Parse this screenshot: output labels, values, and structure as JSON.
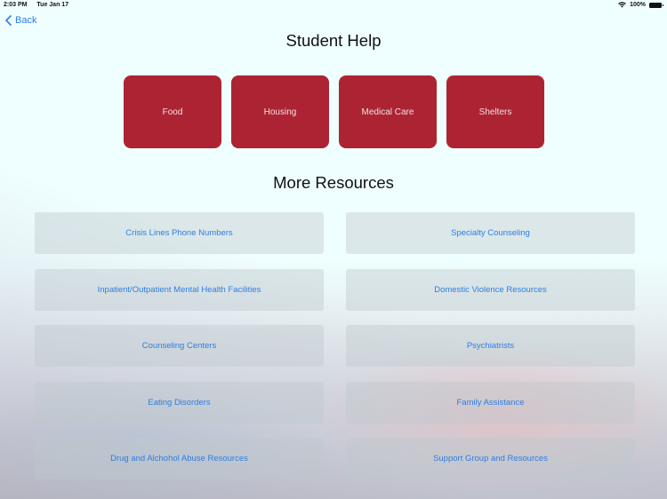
{
  "status_bar": {
    "time": "2:03 PM",
    "date": "Tue Jan 17",
    "battery": "100%",
    "wifi_icon": "wifi-icon",
    "battery_icon": "battery-icon"
  },
  "nav": {
    "back_label": "Back",
    "back_icon": "chevron-left-icon"
  },
  "header": {
    "title": "Student Help"
  },
  "primary_categories": [
    {
      "label": "Food"
    },
    {
      "label": "Housing"
    },
    {
      "label": "Medical Care"
    },
    {
      "label": "Shelters"
    }
  ],
  "more_resources": {
    "title": "More Resources",
    "items": [
      {
        "label": "Crisis Lines Phone Numbers"
      },
      {
        "label": "Specialty Counseling"
      },
      {
        "label": "Inpatient/Outpatient Mental Health Facilities"
      },
      {
        "label": "Domestic Violence Resources"
      },
      {
        "label": "Counseling Centers"
      },
      {
        "label": "Psychiatrists"
      },
      {
        "label": "Eating Disorders"
      },
      {
        "label": "Family Assistance"
      },
      {
        "label": "Drug and Alchohol Abuse Resources"
      },
      {
        "label": "Support Group and Resources"
      }
    ]
  },
  "colors": {
    "accent_blue": "#2f7de0",
    "primary_red": "#ac2433"
  }
}
